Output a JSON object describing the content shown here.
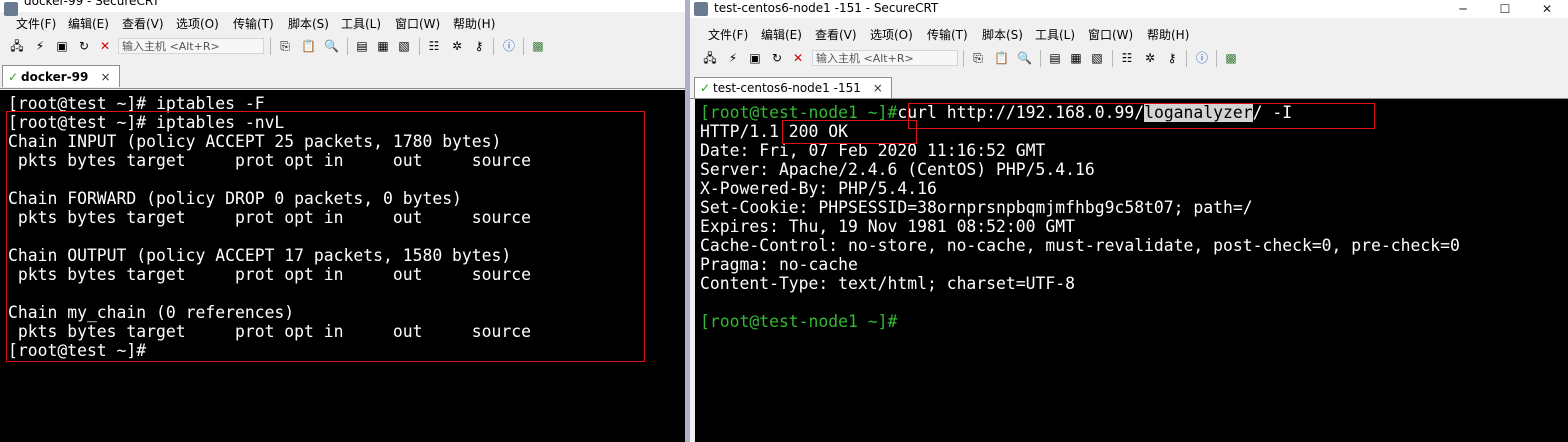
{
  "left": {
    "title": "docker-99 - SecureCRT",
    "menu": [
      "文件(F)",
      "编辑(E)",
      "查看(V)",
      "选项(O)",
      "传输(T)",
      "脚本(S)",
      "工具(L)",
      "窗口(W)",
      "帮助(H)"
    ],
    "host_placeholder": "输入主机 <Alt+R>",
    "tab_label": "docker-99",
    "lines": [
      "[root@test ~]# iptables -F",
      "[root@test ~]# iptables -nvL",
      "Chain INPUT (policy ACCEPT 25 packets, 1780 bytes)",
      " pkts bytes target     prot opt in     out     source",
      "",
      "Chain FORWARD (policy DROP 0 packets, 0 bytes)",
      " pkts bytes target     prot opt in     out     source",
      "",
      "Chain OUTPUT (policy ACCEPT 17 packets, 1580 bytes)",
      " pkts bytes target     prot opt in     out     source",
      "",
      "Chain my_chain (0 references)",
      " pkts bytes target     prot opt in     out     source",
      "[root@test ~]#"
    ]
  },
  "right": {
    "title": "test-centos6-node1 -151 - SecureCRT",
    "menu": [
      "文件(F)",
      "编辑(E)",
      "查看(V)",
      "选项(O)",
      "传输(T)",
      "脚本(S)",
      "工具(L)",
      "窗口(W)",
      "帮助(H)"
    ],
    "host_placeholder": "输入主机 <Alt+R>",
    "tab_label": "test-centos6-node1 -151",
    "prompt": "[root@test-node1 ~]#",
    "cmd_before": "curl http://192.168.0.99/",
    "cmd_highlight": "loganalyzer",
    "cmd_after": "/ -I",
    "lines": [
      "HTTP/1.1 200 OK",
      "Date: Fri, 07 Feb 2020 11:16:52 GMT",
      "Server: Apache/2.4.6 (CentOS) PHP/5.4.16",
      "X-Powered-By: PHP/5.4.16",
      "Set-Cookie: PHPSESSID=38ornprsnpbqmjmfhbg9c58t07; path=/",
      "Expires: Thu, 19 Nov 1981 08:52:00 GMT",
      "Cache-Control: no-store, no-cache, must-revalidate, post-check=0, pre-check=0",
      "Pragma: no-cache",
      "Content-Type: text/html; charset=UTF-8",
      ""
    ],
    "final_prompt": "[root@test-node1 ~]#"
  },
  "icons": [
    "connect-icon",
    "quick-connect-icon",
    "connect-tab-icon",
    "reconnect-icon",
    "disconnect-icon",
    "copy-icon",
    "paste-icon",
    "find-icon",
    "print-icon",
    "print-setup-icon",
    "print-preview-icon",
    "session-options-icon",
    "global-options-icon",
    "keymap-icon",
    "help-icon",
    "sftp-icon"
  ],
  "colors": {
    "prompt_green": "#33b833",
    "highlight_box": "#dd1111",
    "terminal_bg": "#000000"
  }
}
